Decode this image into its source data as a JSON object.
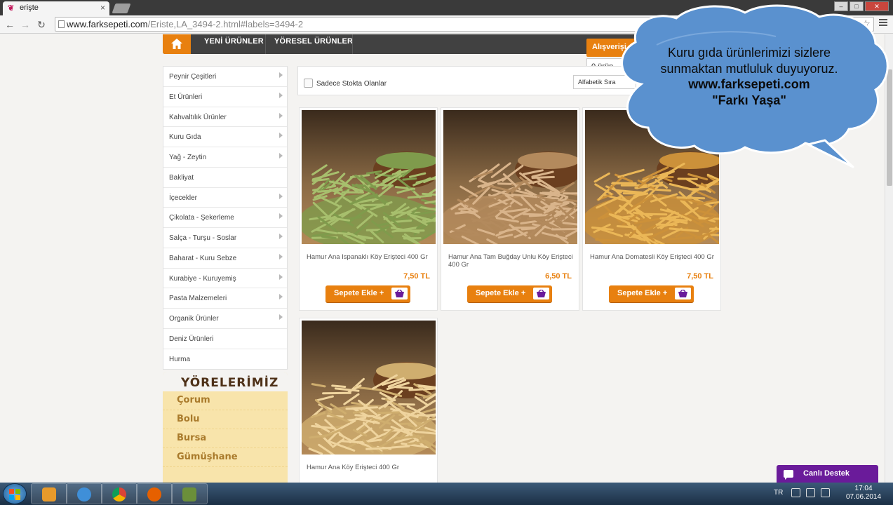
{
  "browser": {
    "tab_title": "erişte",
    "url_host": "www.farksepeti.com",
    "url_path": "/Eriste,LA_3494-2.html#labels=3494-2"
  },
  "nav": {
    "links": [
      "YENİ ÜRÜNLER",
      "YÖRESEL ÜRÜNLER"
    ]
  },
  "cart": {
    "label": "Alışverişi",
    "count": "0 ürün"
  },
  "sidebar": {
    "categories": [
      {
        "label": "Peynir Çeşitleri",
        "has_sub": true
      },
      {
        "label": "Et Ürünleri",
        "has_sub": true
      },
      {
        "label": "Kahvaltılık Ürünler",
        "has_sub": true
      },
      {
        "label": "Kuru Gıda",
        "has_sub": true
      },
      {
        "label": "Yağ - Zeytin",
        "has_sub": true
      },
      {
        "label": "Bakliyat",
        "has_sub": false
      },
      {
        "label": "İçecekler",
        "has_sub": true
      },
      {
        "label": "Çikolata - Şekerleme",
        "has_sub": true
      },
      {
        "label": "Salça - Turşu - Soslar",
        "has_sub": true
      },
      {
        "label": "Baharat - Kuru Sebze",
        "has_sub": true
      },
      {
        "label": "Kurabiye - Kuruyemiş",
        "has_sub": true
      },
      {
        "label": "Pasta Malzemeleri",
        "has_sub": true
      },
      {
        "label": "Organik Ürünler",
        "has_sub": true
      },
      {
        "label": "Deniz Ürünleri",
        "has_sub": false
      },
      {
        "label": "Hurma",
        "has_sub": false
      }
    ]
  },
  "regions": {
    "title": "YÖRELERİMİZ",
    "items": [
      "Çorum",
      "Bolu",
      "Bursa",
      "Gümüşhane"
    ]
  },
  "filter": {
    "stock_only_label": "Sadece Stokta Olanlar",
    "sort_label": "Alfabetik Sıra"
  },
  "products": [
    {
      "name": "Hamur Ana Ispanaklı Köy Erişteci 400 Gr",
      "price": "7,50 TL",
      "button": "Sepete Ekle  +",
      "noodle_color": "#a7bf6d",
      "noodle_dark": "#7f9b4c"
    },
    {
      "name": "Hamur Ana Tam Buğday Unlu Köy Erişteci 400 Gr",
      "price": "6,50 TL",
      "button": "Sepete Ekle  +",
      "noodle_color": "#d9b48b",
      "noodle_dark": "#b38a5d"
    },
    {
      "name": "Hamur Ana Domatesli Köy Erişteci 400 Gr",
      "price": "7,50 TL",
      "button": "Sepete Ekle  +",
      "noodle_color": "#ebb757",
      "noodle_dark": "#cc913a"
    },
    {
      "name": "Hamur Ana Köy Erişteci 400 Gr",
      "price": "",
      "button": "",
      "noodle_color": "#efd49e",
      "noodle_dark": "#cfae6f"
    }
  ],
  "bubble": {
    "line1": "Kuru gıda ürünlerimizi sizlere",
    "line2": "sunmaktan mutluluk duyuyoruz.",
    "line3": "www.farksepeti.com",
    "line4": "\"Farkı Yaşa\""
  },
  "live_support": "Canlı Destek",
  "taskbar": {
    "lang": "TR",
    "time": "17:04",
    "date": "07.06.2014"
  },
  "colors": {
    "accent": "#e8800f",
    "nav_bg": "#414141",
    "support": "#6a1b9a"
  }
}
